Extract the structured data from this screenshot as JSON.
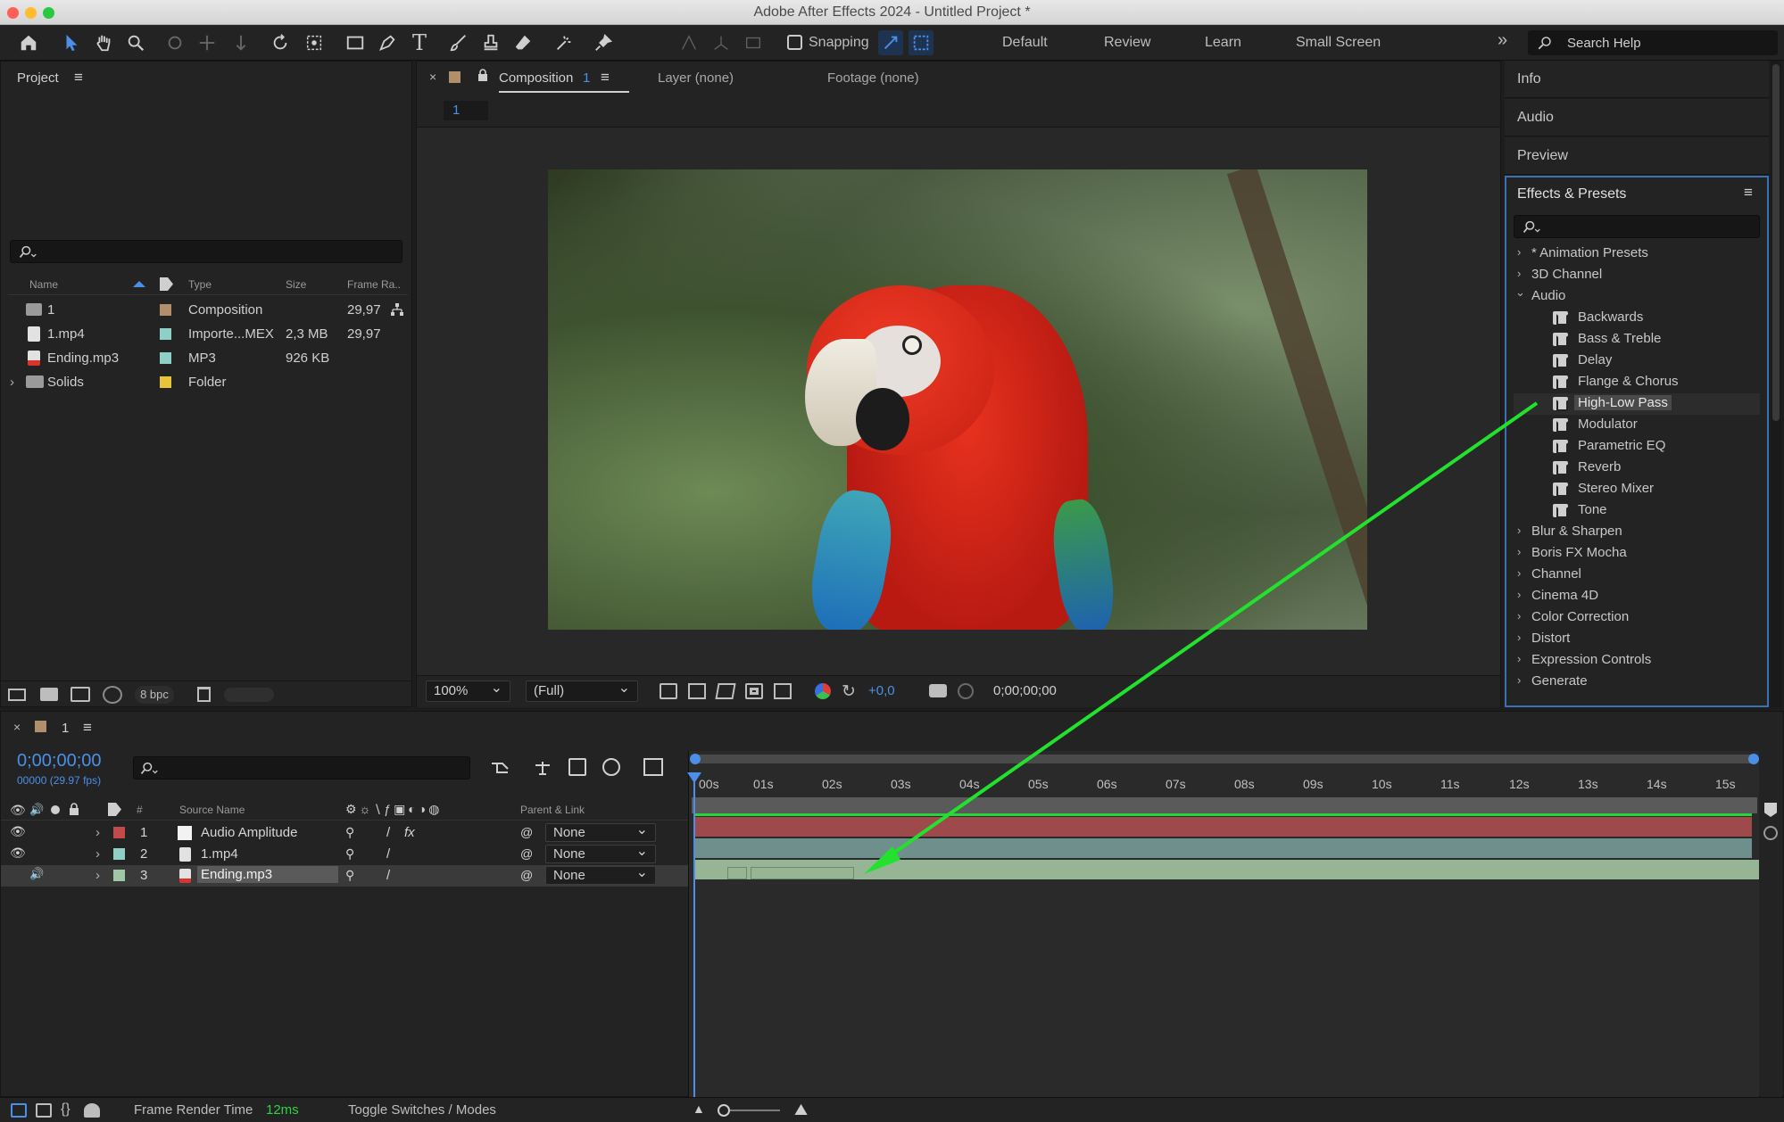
{
  "window": {
    "title": "Adobe After Effects 2024 - Untitled Project *"
  },
  "toolbar": {
    "snapping_label": "Snapping",
    "workspaces": [
      "Default",
      "Review",
      "Learn",
      "Small Screen"
    ],
    "search_placeholder": "Search Help"
  },
  "project": {
    "tab_label": "Project",
    "columns": {
      "name": "Name",
      "type": "Type",
      "size": "Size",
      "frame_rate": "Frame Ra.."
    },
    "items": [
      {
        "name": "1",
        "type": "Composition",
        "size": "",
        "fps": "29,97",
        "color": "#b08f6a"
      },
      {
        "name": "1.mp4",
        "type": "Importe...MEX",
        "size": "2,3 MB",
        "fps": "29,97",
        "color": "#8ecfc8"
      },
      {
        "name": "Ending.mp3",
        "type": "MP3",
        "size": "926 KB",
        "fps": "",
        "color": "#8ecfc8"
      },
      {
        "name": "Solids",
        "type": "Folder",
        "size": "",
        "fps": "",
        "color": "#e6c53a"
      }
    ],
    "bpc_label": "8 bpc"
  },
  "composition": {
    "tab_label": "Composition",
    "tab_number": "1",
    "layer_tab": "Layer (none)",
    "footage_tab": "Footage (none)",
    "breadcrumb": "1",
    "zoom": "100%",
    "resolution": "(Full)",
    "exposure": "+0,0",
    "timecode": "0;00;00;00"
  },
  "right_panels": {
    "tabs": [
      "Info",
      "Audio",
      "Preview"
    ],
    "effects_title": "Effects & Presets",
    "categories_top": [
      {
        "label": "* Animation Presets",
        "open": false
      },
      {
        "label": "3D Channel",
        "open": false
      },
      {
        "label": "Audio",
        "open": true
      }
    ],
    "audio_effects": [
      "Backwards",
      "Bass & Treble",
      "Delay",
      "Flange & Chorus",
      "High-Low Pass",
      "Modulator",
      "Parametric EQ",
      "Reverb",
      "Stereo Mixer",
      "Tone"
    ],
    "selected_effect": "High-Low Pass",
    "categories_bottom": [
      "Blur & Sharpen",
      "Boris FX Mocha",
      "Channel",
      "Cinema 4D",
      "Color Correction",
      "Distort",
      "Expression Controls",
      "Generate"
    ]
  },
  "timeline": {
    "tab_label": "1",
    "timecode": "0;00;00;00",
    "fps_info": "00000 (29.97 fps)",
    "columns": {
      "number": "#",
      "source_name": "Source Name",
      "parent": "Parent & Link"
    },
    "ruler": [
      "00s",
      "01s",
      "02s",
      "03s",
      "04s",
      "05s",
      "06s",
      "07s",
      "08s",
      "09s",
      "10s",
      "11s",
      "12s",
      "13s",
      "14s",
      "15s"
    ],
    "layers": [
      {
        "num": "1",
        "name": "Audio Amplitude",
        "parent": "None",
        "label_color": "#c24a4a",
        "bar_color": "#9e4a4c"
      },
      {
        "num": "2",
        "name": "1.mp4",
        "parent": "None",
        "label_color": "#8ecfc8",
        "bar_color": "#6e8f8c"
      },
      {
        "num": "3",
        "name": "Ending.mp3",
        "parent": "None",
        "label_color": "#9fc7a5",
        "bar_color": "#95b595"
      }
    ]
  },
  "status_bar": {
    "render_label": "Frame Render Time",
    "render_value": "12ms",
    "toggle_label": "Toggle Switches / Modes"
  }
}
